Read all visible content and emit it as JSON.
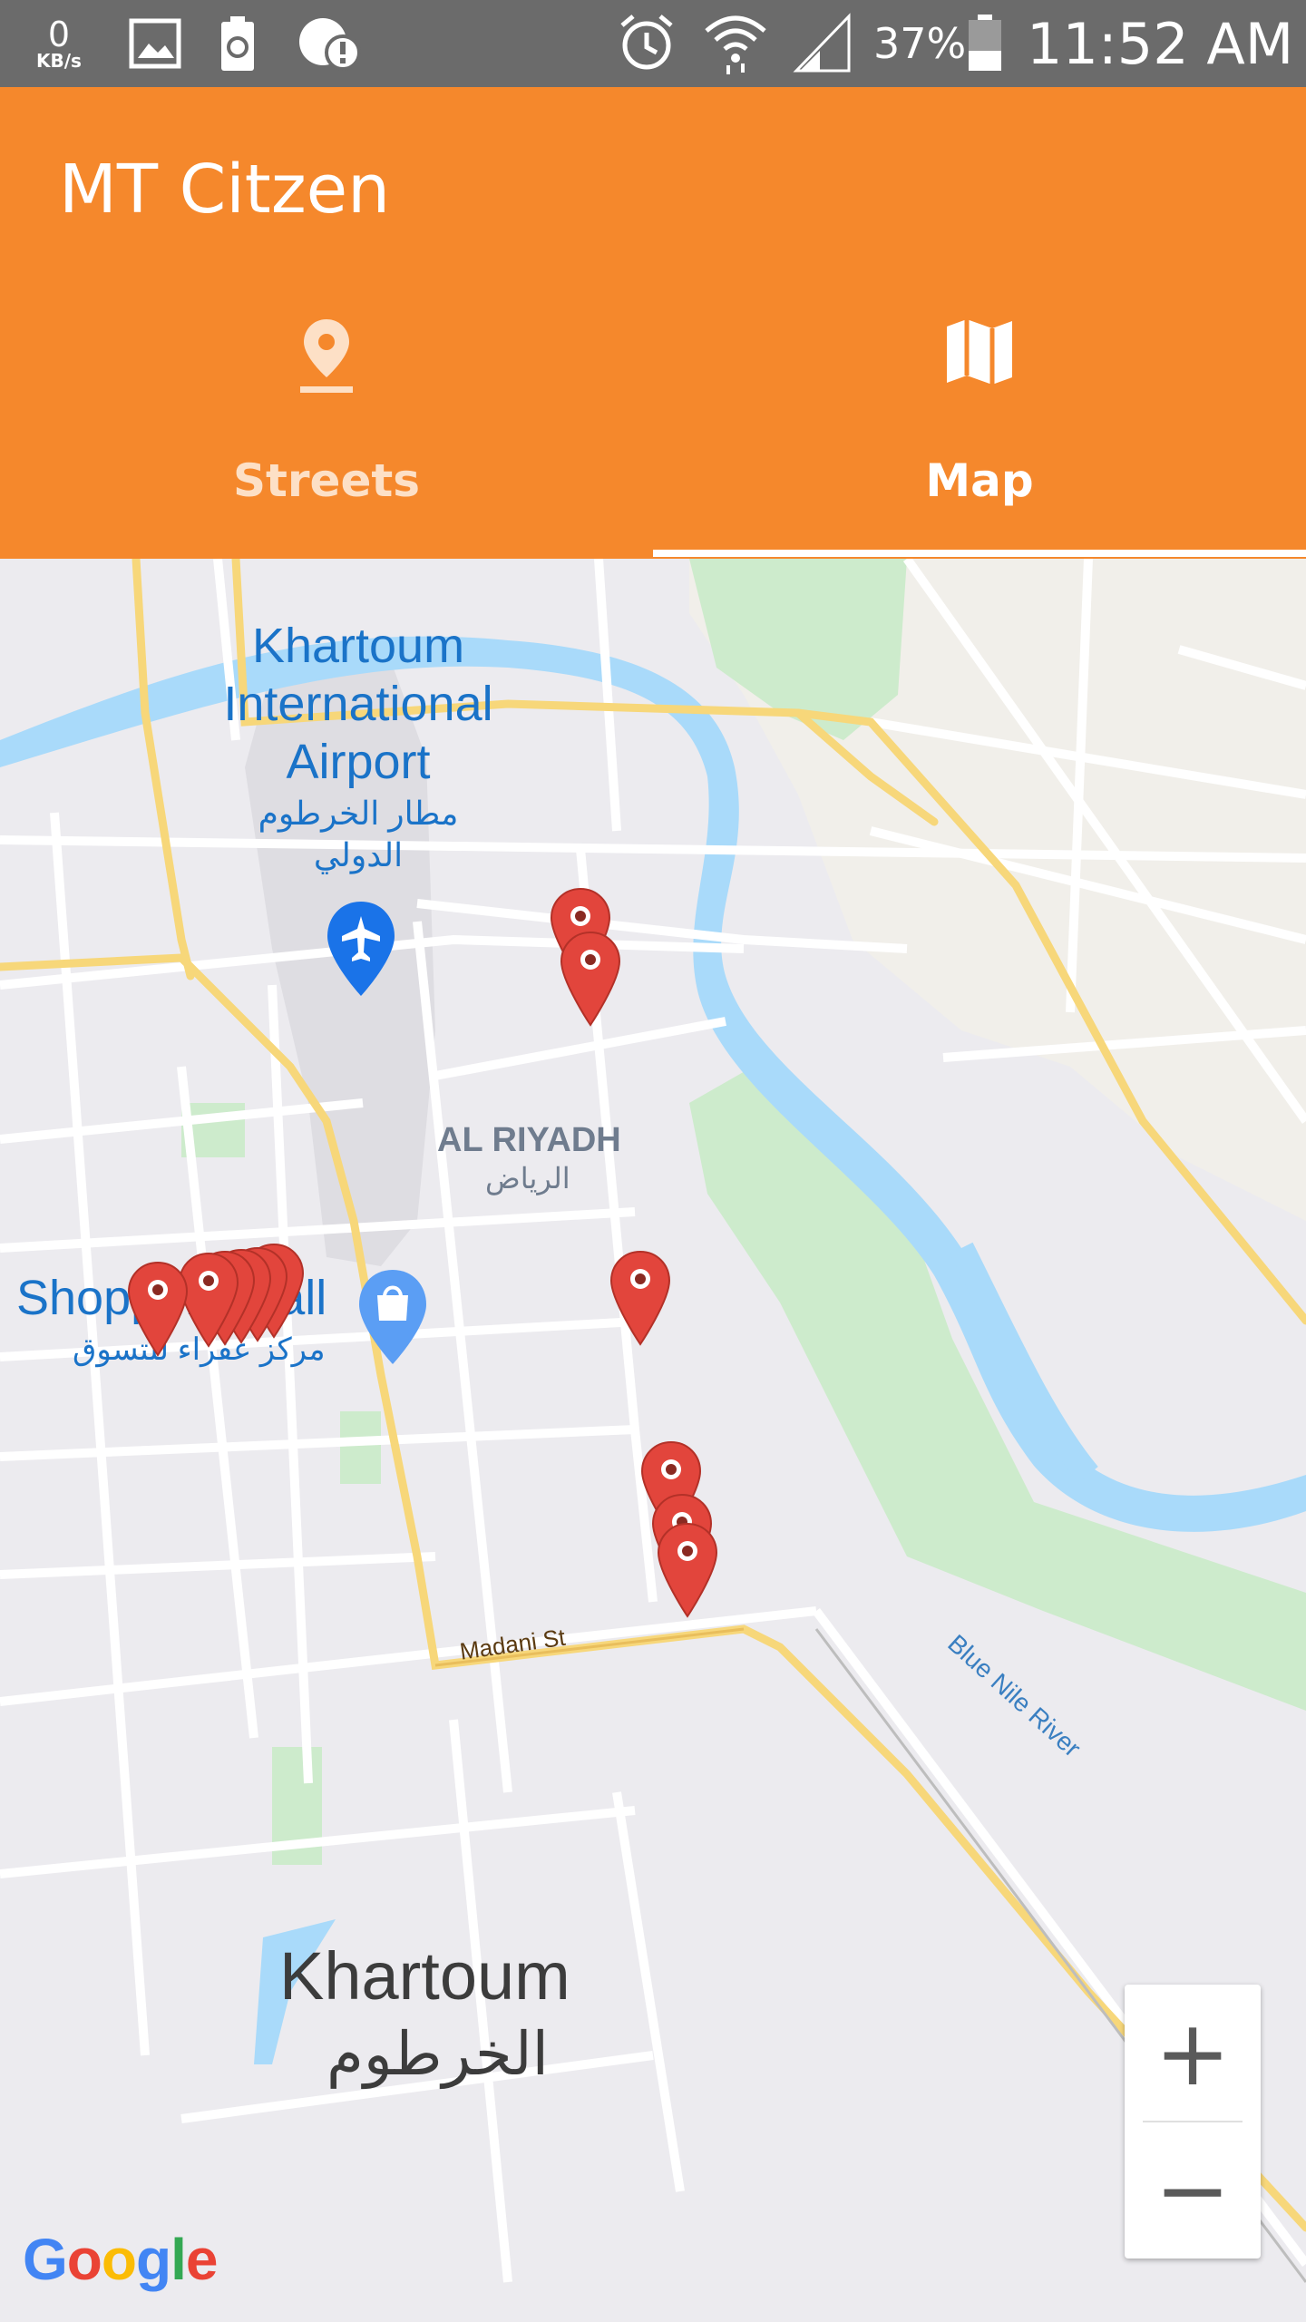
{
  "status_bar": {
    "speed_value": "0",
    "speed_unit": "KB/s",
    "battery_percent": "37%",
    "time": "11:52 AM",
    "icons": [
      "image-icon",
      "recycle-icon",
      "alert-icon",
      "alarm-icon",
      "wifi-icon",
      "signal-icon",
      "battery-icon"
    ]
  },
  "app_bar": {
    "title": "MT Citzen",
    "background_color": "#f5882c"
  },
  "tabs": [
    {
      "label": "Streets",
      "icon": "location-pin-icon",
      "selected": false
    },
    {
      "label": "Map",
      "icon": "map-icon",
      "selected": true
    }
  ],
  "map": {
    "labels": {
      "airport_en": "Khartoum\nInternational\nAirport",
      "airport_ar": "مطار الخرطوم\nالدولي",
      "district_en": "AL RIYADH",
      "district_ar": "الرياض",
      "mall_en": "Shopping Mall",
      "mall_ar": "مركز عفراء للتسوق",
      "city_en": "Khartoum",
      "city_ar": "الخرطوم",
      "street": "Madani St",
      "river": "Blue Nile River"
    },
    "marker_color": "#e2453c",
    "zoom_in_label": "+",
    "zoom_out_label": "−",
    "attribution": "Google"
  }
}
